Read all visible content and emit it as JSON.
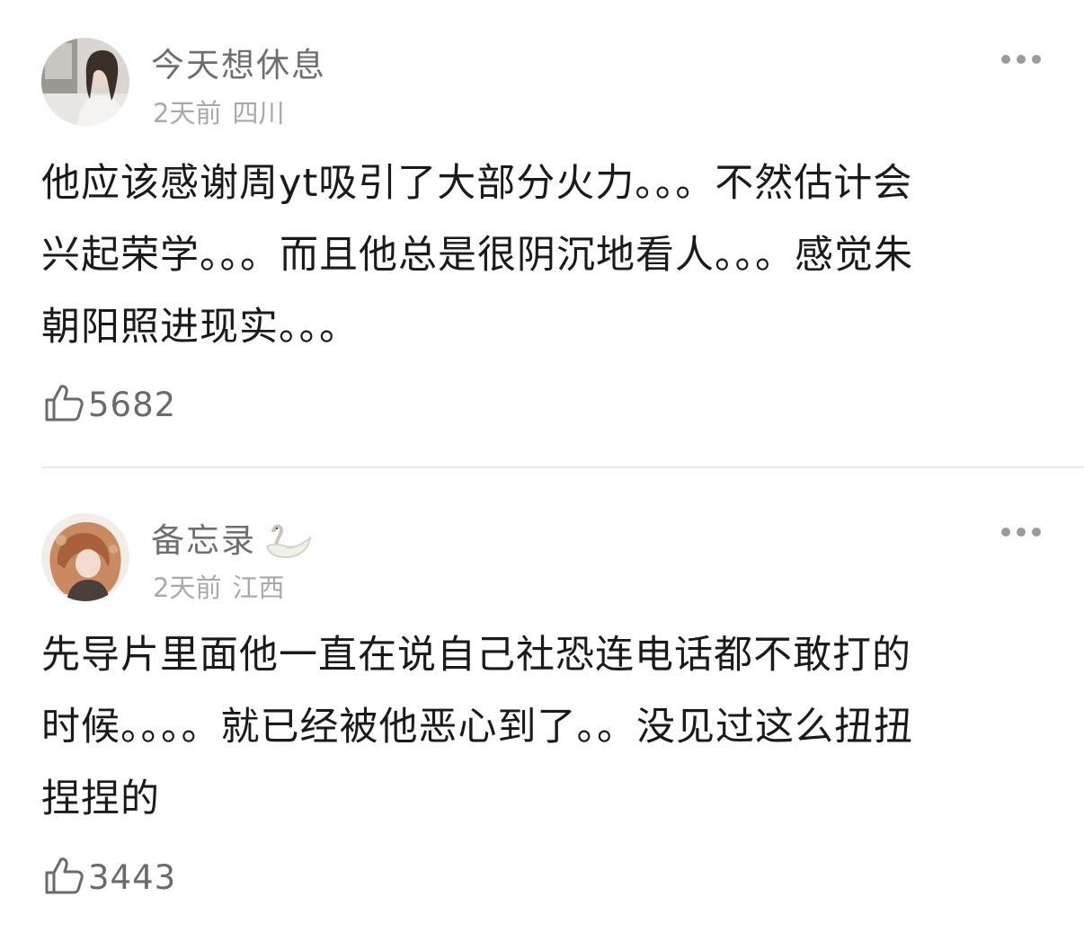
{
  "comments": [
    {
      "username": "今天想休息",
      "time": "2天前",
      "location": "四川",
      "content_lines": [
        "他应该感谢周yt吸引了大部分火力。。。不然估计会",
        "兴起荣学。。。而且他总是很阴沉地看人。。。感觉朱",
        "朝阳照进现实。。。"
      ],
      "likes": "5682",
      "icons": {
        "more": "more-icon",
        "like": "thumbs-up-icon"
      }
    },
    {
      "username": "备忘录",
      "time": "2天前",
      "location": "江西",
      "content_lines": [
        "先导片里面他一直在说自己社恐连电话都不敢打的",
        "时候。。。。就已经被他恶心到了。。没见过这么扭扭",
        "捏捏的"
      ],
      "likes": "3443",
      "icons": {
        "badge": "swan-icon",
        "more": "more-icon",
        "like": "thumbs-up-icon"
      }
    }
  ],
  "colors": {
    "username": "#6f6f6f",
    "meta": "#a9a9a9",
    "content": "#1a1a1a",
    "divider": "#e8e8e8"
  }
}
